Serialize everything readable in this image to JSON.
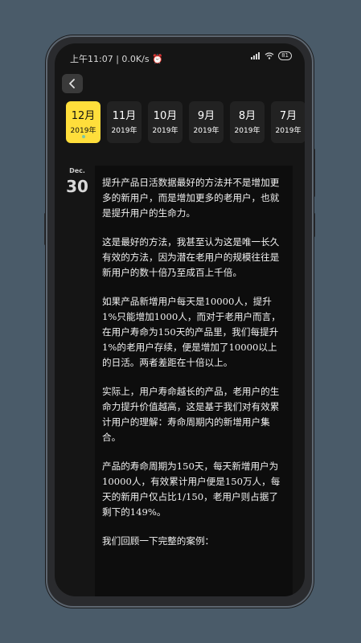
{
  "status_bar": {
    "time": "上午11:07",
    "speed": "0.0K/s",
    "battery": "81"
  },
  "dates": [
    {
      "month": "12月",
      "year": "2019年",
      "active": true
    },
    {
      "month": "11月",
      "year": "2019年",
      "active": false
    },
    {
      "month": "10月",
      "year": "2019年",
      "active": false
    },
    {
      "month": "9月",
      "year": "2019年",
      "active": false
    },
    {
      "month": "8月",
      "year": "2019年",
      "active": false
    },
    {
      "month": "7月",
      "year": "2019年",
      "active": false
    }
  ],
  "day": {
    "month_abbr": "Dec.",
    "number": "30"
  },
  "article": {
    "paragraphs": [
      "提升产品日活数据最好的方法并不是增加更多的新用户，而是增加更多的老用户，也就是提升用户的生命力。",
      "这是最好的方法，我甚至认为这是唯一长久有效的方法，因为潜在老用户的规模往往是新用户的数十倍乃至成百上千倍。",
      "如果产品新增用户每天是10000人，提升1%只能增加1000人，而对于老用户而言，在用户寿命为150天的产品里，我们每提升1%的老用户存续，便是增加了10000以上的日活。两者差距在十倍以上。",
      "实际上，用户寿命越长的产品，老用户的生命力提升价值越高，这是基于我们对有效累计用户的理解：寿命周期内的新增用户集合。",
      "产品的寿命周期为150天，每天新增用户为10000人，有效累计用户便是150万人，每天的新用户仅占比1/150，老用户则占据了剩下的149%。",
      "我们回顾一下完整的案例："
    ]
  }
}
